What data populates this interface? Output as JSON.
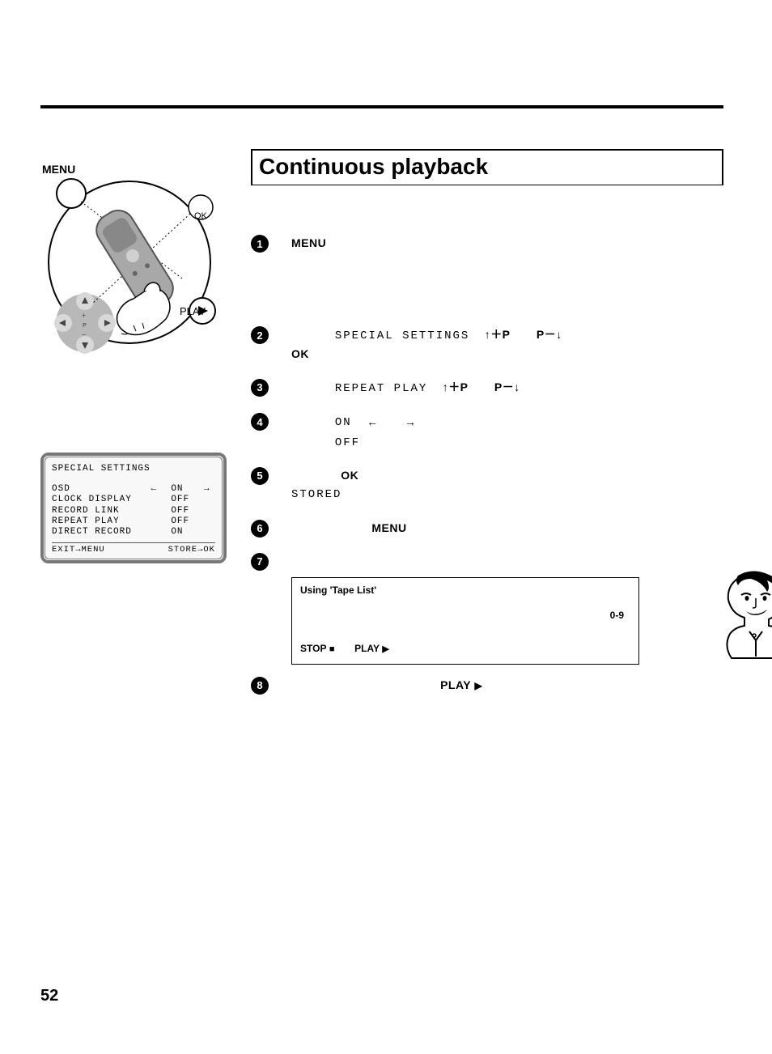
{
  "pageNumber": "52",
  "title": "Continuous playback",
  "sidebar": {
    "labels": {
      "menu": "MENU",
      "ok": "OK",
      "play": "PLAY"
    },
    "tv": {
      "heading": "SPECIAL SETTINGS",
      "rows": [
        {
          "label": "OSD",
          "mark": "←",
          "value": "ON",
          "arrow": "→"
        },
        {
          "label": "CLOCK DISPLAY",
          "mark": "",
          "value": "OFF",
          "arrow": ""
        },
        {
          "label": "RECORD LINK",
          "mark": "",
          "value": "OFF",
          "arrow": ""
        },
        {
          "label": "REPEAT PLAY",
          "mark": "",
          "value": "OFF",
          "arrow": ""
        },
        {
          "label": "DIRECT RECORD",
          "mark": "",
          "value": "ON",
          "arrow": ""
        }
      ],
      "footLeft": "EXIT→MENU",
      "footRight": "STORE→OK"
    }
  },
  "steps": {
    "s1": {
      "n": "1",
      "menu": "MENU"
    },
    "s2": {
      "n": "2",
      "special": "SPECIAL SETTINGS",
      "upP": "↑＋P",
      "pDown": "P－↓",
      "ok": "OK"
    },
    "s3": {
      "n": "3",
      "repeat": "REPEAT PLAY",
      "upP": "↑＋P",
      "pDown": "P－↓"
    },
    "s4": {
      "n": "4",
      "on": "ON",
      "off": "OFF",
      "left": "←",
      "right": "→"
    },
    "s5": {
      "n": "5",
      "ok": "OK",
      "stored": "STORED"
    },
    "s6": {
      "n": "6",
      "menu": "MENU"
    },
    "s7": {
      "n": "7"
    },
    "s8": {
      "n": "8",
      "play": "PLAY",
      "playIcon": "▶"
    }
  },
  "tip": {
    "title": "Using 'Tape List'",
    "numbers": "0-9",
    "stop": "STOP",
    "stopIcon": "■",
    "play": "PLAY",
    "playIcon": "▶"
  }
}
